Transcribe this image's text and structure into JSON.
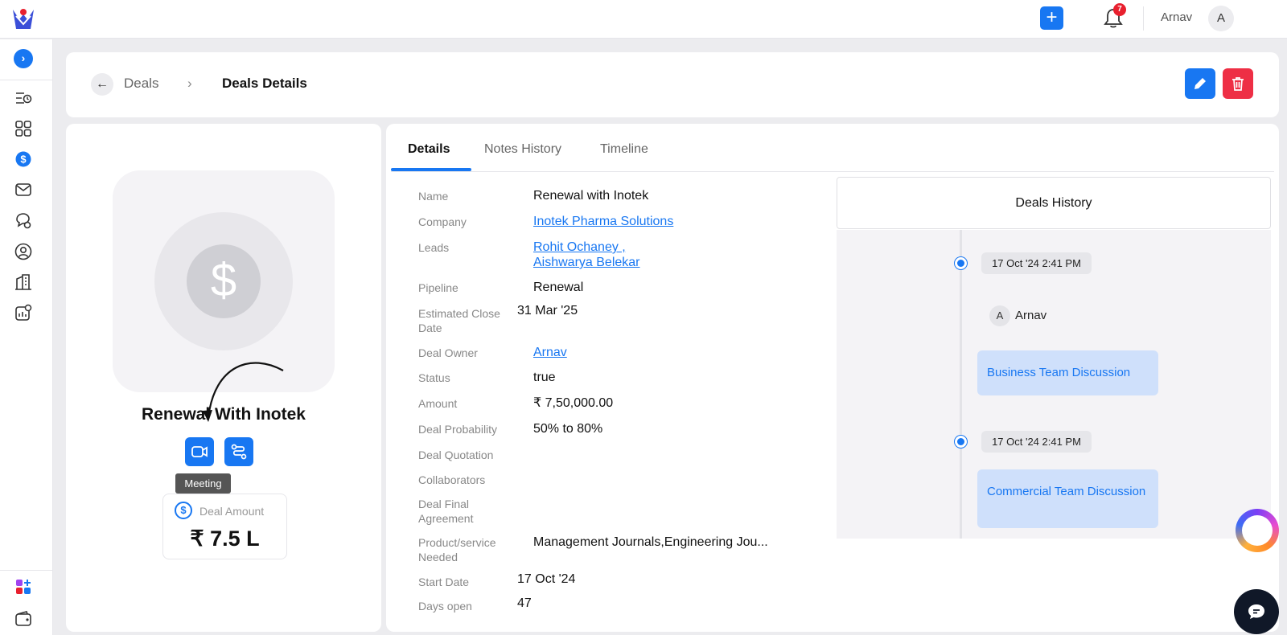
{
  "topbar": {
    "notification_count": "7",
    "user_name": "Arnav",
    "user_initial": "A"
  },
  "breadcrumb": {
    "parent": "Deals",
    "current": "Deals Details"
  },
  "deal": {
    "title": "Renewal With Inotek",
    "tooltip": "Meeting",
    "amount_label": "Deal Amount",
    "amount_value": "₹ 7.5 L"
  },
  "tabs": [
    "Details",
    "Notes History",
    "Timeline"
  ],
  "details": {
    "name_label": "Name",
    "name": "Renewal with Inotek",
    "company_label": "Company",
    "company": "Inotek Pharma Solutions",
    "leads_label": "Leads",
    "lead_1": "Rohit Ochaney ,",
    "lead_2": "Aishwarya Belekar",
    "pipeline_label": "Pipeline",
    "pipeline": "Renewal",
    "close_date_label": "Estimated Close Date",
    "close_date": "31 Mar '25",
    "owner_label": "Deal Owner",
    "owner": "Arnav",
    "status_label": "Status",
    "status": "true",
    "amount_label": "Amount",
    "amount": "₹ 7,50,000.00",
    "probability_label": "Deal Probability",
    "probability": "50% to 80%",
    "quotation_label": "Deal Quotation",
    "collaborators_label": "Collaborators",
    "final_agreement_label": "Deal Final Agreement",
    "product_label": "Product/service Needed",
    "product": "Management Journals,Engineering Jou...",
    "start_date_label": "Start Date",
    "start_date": "17 Oct '24",
    "days_open_label": "Days open",
    "days_open": "47"
  },
  "history": {
    "title": "Deals History",
    "entries": [
      {
        "time": "17 Oct '24 2:41 PM",
        "user_initial": "A",
        "user": "Arnav",
        "note": "Business Team Discussion"
      },
      {
        "time": "17 Oct '24 2:41 PM",
        "note": "Commercial Team Discussion"
      }
    ]
  },
  "colors": {
    "accent": "#1877f2",
    "danger": "#ee2f45",
    "history_card": "#cfe0fb"
  },
  "icons": [
    "app-logo-icon",
    "plus-icon",
    "bell-icon",
    "chevron-right-icon",
    "back-arrow-icon",
    "pencil-icon",
    "trash-icon",
    "dollar-icon",
    "video-icon",
    "route-icon",
    "chat-icon"
  ]
}
